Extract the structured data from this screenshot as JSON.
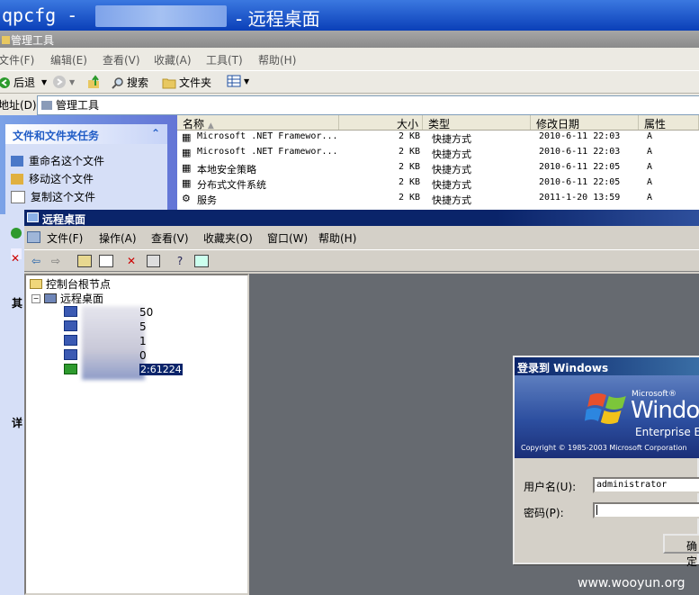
{
  "outer_window": {
    "title_left": "qpcfg -",
    "title_right": "- 远程桌面"
  },
  "explorer": {
    "title": "管理工具",
    "menu": [
      "文件(F)",
      "编辑(E)",
      "查看(V)",
      "收藏(A)",
      "工具(T)",
      "帮助(H)"
    ],
    "toolbar": {
      "back": "后退",
      "search": "搜索",
      "folders": "文件夹"
    },
    "address_label": "地址(D)",
    "address_value": "管理工具",
    "task_pane": {
      "header": "文件和文件夹任务",
      "items": [
        "重命名这个文件",
        "移动这个文件",
        "复制这个文件"
      ]
    },
    "columns": [
      "名称",
      "大小",
      "类型",
      "修改日期",
      "属性"
    ],
    "rows": [
      {
        "name": "Microsoft .NET Framewor...",
        "size": "2 KB",
        "type": "快捷方式",
        "date": "2010-6-11 22:03",
        "attr": "A"
      },
      {
        "name": "Microsoft .NET Framewor...",
        "size": "2 KB",
        "type": "快捷方式",
        "date": "2010-6-11 22:03",
        "attr": "A"
      },
      {
        "name": "本地安全策略",
        "size": "2 KB",
        "type": "快捷方式",
        "date": "2010-6-11 22:05",
        "attr": "A"
      },
      {
        "name": "分布式文件系统",
        "size": "2 KB",
        "type": "快捷方式",
        "date": "2010-6-11 22:05",
        "attr": "A"
      },
      {
        "name": "服务",
        "size": "2 KB",
        "type": "快捷方式",
        "date": "2011-1-20 13:59",
        "attr": "A"
      }
    ],
    "left_strip_labels": [
      "其",
      "详"
    ]
  },
  "mmc": {
    "title": "远程桌面",
    "menu": [
      "文件(F)",
      "操作(A)",
      "查看(V)",
      "收藏夹(O)",
      "窗口(W)",
      "帮助(H)"
    ],
    "tree": {
      "root": "控制台根节点",
      "child": "远程桌面",
      "servers": [
        "50",
        "5",
        "1",
        "0",
        "2:61224"
      ]
    }
  },
  "login_dialog": {
    "title": "登录到 Windows",
    "brand_small": "Microsoft®",
    "brand_big": "Window",
    "brand_edition": "Enterprise Ed",
    "copyright": "Copyright © 1985-2003  Microsoft Corporation",
    "username_label": "用户名(U):",
    "username_value": "administrator",
    "password_label": "密码(P):",
    "password_value": "",
    "ok_label": "确定"
  },
  "watermark": "www.wooyun.org"
}
